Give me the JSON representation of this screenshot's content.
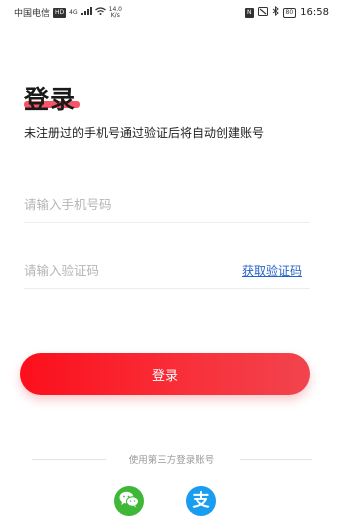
{
  "status_bar": {
    "carrier": "中国电信",
    "hd_badge": "HD",
    "network": "4G",
    "speed_value": "14.0",
    "speed_unit": "K/s",
    "nfc": "N",
    "battery": "80",
    "time": "16:58"
  },
  "login": {
    "title": "登录",
    "subtitle": "未注册过的手机号通过验证后将自动创建账号",
    "phone_placeholder": "请输入手机号码",
    "code_placeholder": "请输入验证码",
    "get_code_label": "获取验证码",
    "submit_label": "登录",
    "third_party_label": "使用第三方登录账号"
  },
  "colors": {
    "accent": "#f8313b",
    "link": "#2563c9",
    "wechat": "#3fb837",
    "alipay": "#1a9cf0"
  },
  "icons": {
    "wechat": "wechat-icon",
    "alipay": "alipay-icon"
  }
}
